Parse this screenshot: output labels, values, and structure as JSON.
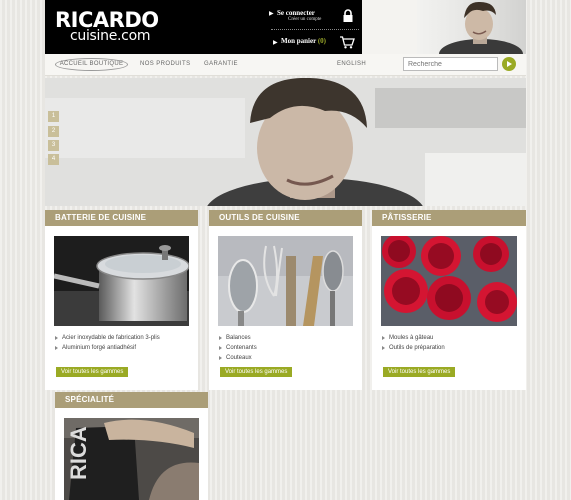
{
  "header": {
    "logo_top": "RICARDO",
    "logo_bottom": "cuisine.com",
    "login_label": "Se connecter",
    "register_label": "Créer un compte",
    "cart_label": "Mon panier",
    "cart_count": "(0)"
  },
  "nav": {
    "home": "ACCUEIL BOUTIQUE",
    "products": "NOS PRODUITS",
    "warranty": "GARANTIE",
    "language": "ENGLISH",
    "search_placeholder": "Recherche"
  },
  "slider": {
    "numbers": [
      "1",
      "2",
      "3",
      "4"
    ]
  },
  "panels": [
    {
      "title": "BATTERIE DE CUISINE",
      "items": [
        "Acier inoxydable de fabrication 3-plis",
        "Aluminium forgé antiadhésif"
      ],
      "button": "Voir toutes les gammes"
    },
    {
      "title": "OUTILS DE CUISINE",
      "items": [
        "Balances",
        "Contenants",
        "Couteaux"
      ],
      "button": "Voir toutes les gammes"
    },
    {
      "title": "PÂTISSERIE",
      "items": [
        "Moules à gâteau",
        "Outils de préparation"
      ],
      "button": "Voir toutes les gammes"
    },
    {
      "title": "SPÉCIALITÉ"
    }
  ],
  "colors": {
    "panel_header": "#ab9e78",
    "accent_green": "#9aaa24",
    "logo_bg": "#000000"
  }
}
